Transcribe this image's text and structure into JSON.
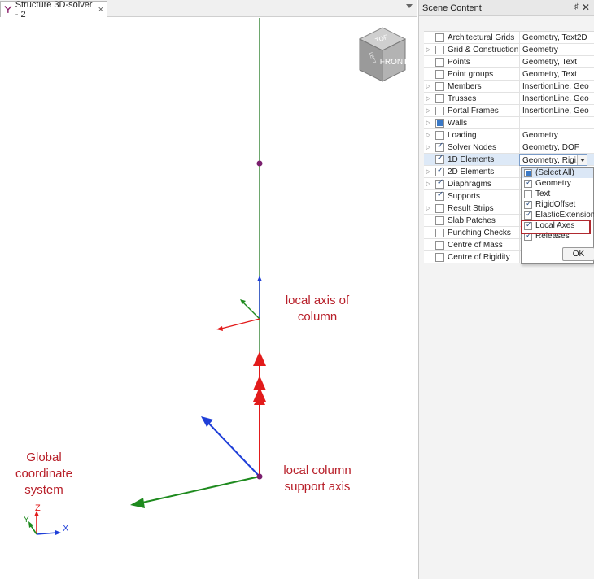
{
  "document_tab": {
    "title": "Structure 3D-solver - 2",
    "close_glyph": "×"
  },
  "viewcube": {
    "top": "TOP",
    "front": "FRONT",
    "left": "LEFT"
  },
  "annotations": {
    "local_axis_column": [
      "local axis of",
      "column"
    ],
    "global_coordinate": [
      "Global",
      "coordinate",
      "system"
    ],
    "local_column_support": [
      "local column",
      "support axis"
    ]
  },
  "axis_triad": {
    "z": "Z",
    "y": "Y",
    "x": "X"
  },
  "panel": {
    "title": "Scene Content",
    "pin_glyph": "♯",
    "close_glyph": "✕"
  },
  "rows": [
    {
      "name": "Architectural Grids",
      "value": "Geometry, Text2D",
      "expandable": false,
      "state": "unchecked"
    },
    {
      "name": "Grid & Construction ...",
      "value": "Geometry",
      "expandable": true,
      "state": "unchecked"
    },
    {
      "name": "Points",
      "value": "Geometry, Text",
      "expandable": false,
      "state": "unchecked"
    },
    {
      "name": "Point groups",
      "value": "Geometry, Text",
      "expandable": false,
      "state": "unchecked"
    },
    {
      "name": "Members",
      "value": "InsertionLine, Geo...",
      "expandable": true,
      "state": "unchecked"
    },
    {
      "name": "Trusses",
      "value": "InsertionLine, Geo...",
      "expandable": true,
      "state": "unchecked"
    },
    {
      "name": "Portal Frames",
      "value": "InsertionLine, Geo...",
      "expandable": true,
      "state": "unchecked"
    },
    {
      "name": "Walls",
      "value": "",
      "expandable": true,
      "state": "partial"
    },
    {
      "name": "Loading",
      "value": "Geometry",
      "expandable": true,
      "state": "unchecked"
    },
    {
      "name": "Solver Nodes",
      "value": "Geometry, DOF",
      "expandable": true,
      "state": "checked"
    },
    {
      "name": "1D Elements",
      "value": "Geometry, Rigi...",
      "expandable": false,
      "state": "checked",
      "selected": true
    },
    {
      "name": "2D Elements",
      "value": "",
      "expandable": true,
      "state": "checked"
    },
    {
      "name": "Diaphragms",
      "value": "",
      "expandable": true,
      "state": "checked"
    },
    {
      "name": "Supports",
      "value": "",
      "expandable": false,
      "state": "checked"
    },
    {
      "name": "Result Strips",
      "value": "",
      "expandable": true,
      "state": "unchecked"
    },
    {
      "name": "Slab Patches",
      "value": "",
      "expandable": false,
      "state": "unchecked"
    },
    {
      "name": "Punching Checks",
      "value": "",
      "expandable": false,
      "state": "unchecked"
    },
    {
      "name": "Centre of Mass",
      "value": "",
      "expandable": false,
      "state": "unchecked"
    },
    {
      "name": "Centre of Rigidity",
      "value": "",
      "expandable": false,
      "state": "unchecked"
    }
  ],
  "popup": {
    "items": [
      {
        "label": "(Select All)",
        "state": "partial"
      },
      {
        "label": "Geometry",
        "state": "checked"
      },
      {
        "label": "Text",
        "state": "unchecked"
      },
      {
        "label": "RigidOffset",
        "state": "checked"
      },
      {
        "label": "ElasticExtension",
        "state": "checked"
      },
      {
        "label": "Local Axes",
        "state": "checked"
      },
      {
        "label": "Releases",
        "state": "checked"
      }
    ],
    "ok_label": "OK"
  },
  "colors": {
    "annotation": "#b8202a",
    "column": "#3f8a3f",
    "axis_red": "#e21b1b",
    "axis_green": "#1e8a1e",
    "axis_blue": "#1f3fd8",
    "node": "#7a1f6e",
    "highlight": "#b02a30"
  }
}
